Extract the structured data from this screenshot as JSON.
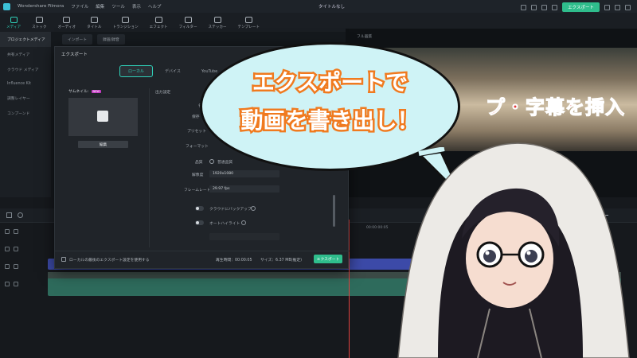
{
  "app": {
    "name": "Wondershare Filmora",
    "menu": [
      "ファイル",
      "編集",
      "ツール",
      "表示",
      "ヘルプ"
    ],
    "project_title": "タイトルなし",
    "export_button": "エクスポート"
  },
  "toolbar": {
    "items": [
      {
        "label": "メディア",
        "active": true
      },
      {
        "label": "ストック",
        "active": false
      },
      {
        "label": "オーディオ",
        "active": false
      },
      {
        "label": "タイトル",
        "active": false
      },
      {
        "label": "トランジション",
        "active": false
      },
      {
        "label": "エフェクト",
        "active": false
      },
      {
        "label": "フィルター",
        "active": false
      },
      {
        "label": "ステッカー",
        "active": false
      },
      {
        "label": "テンプレート",
        "active": false
      }
    ]
  },
  "media_panel": {
    "import_chip": "インポート",
    "record_chip": "録画/録音",
    "sidebar": [
      {
        "label": "プロジェクトメディア",
        "selected": true
      },
      {
        "label": "共有メディア",
        "selected": false
      },
      {
        "label": "クラウド メディア",
        "selected": false
      },
      {
        "label": "Influence Kit",
        "selected": false
      },
      {
        "label": "調整レイヤー",
        "selected": false
      },
      {
        "label": "コンプーンド",
        "selected": false
      }
    ]
  },
  "preview": {
    "overlay_text": "プ・字幕を挿入",
    "quality_label": "フル画質"
  },
  "export_dialog": {
    "title": "エクスポート",
    "tabs": [
      {
        "label": "ローカル",
        "active": true
      },
      {
        "label": "デバイス",
        "active": false
      },
      {
        "label": "YouTube",
        "active": false
      }
    ],
    "thumbnail_label": "サムネイル:",
    "thumbnail_badge": "NEW",
    "edit_button": "編集",
    "output_settings": "出力設定",
    "fields": {
      "name_label": "名",
      "save_label": "保存",
      "preset_label": "プリセット",
      "format_label": "フォーマット",
      "quality_label": "品質",
      "quality_value": "普通品質",
      "resolution_label": "解像度",
      "resolution_value": "1920x1080",
      "framerate_label": "フレームレート",
      "framerate_value": "29.97 fps",
      "cloud_backup": "クラウドにバックアップ",
      "auto_highlight": "オートハイライト"
    },
    "footer": {
      "use_last_settings": "ローカルの最後のエクスポート設定を使用する",
      "duration": "再生時間：00:00:05",
      "size": "サイズ：6.37 MB(推定)",
      "export_button": "エクスポート"
    }
  },
  "timeline": {
    "ruler": [
      "00:00:00:05"
    ]
  },
  "caption": {
    "line1": "エクスポートで",
    "line2": "動画を書き出し！"
  },
  "colors": {
    "accent": "#2fbd8c",
    "caption_stroke": "#f07a1f",
    "bubble_fill": "#cff3f6"
  }
}
